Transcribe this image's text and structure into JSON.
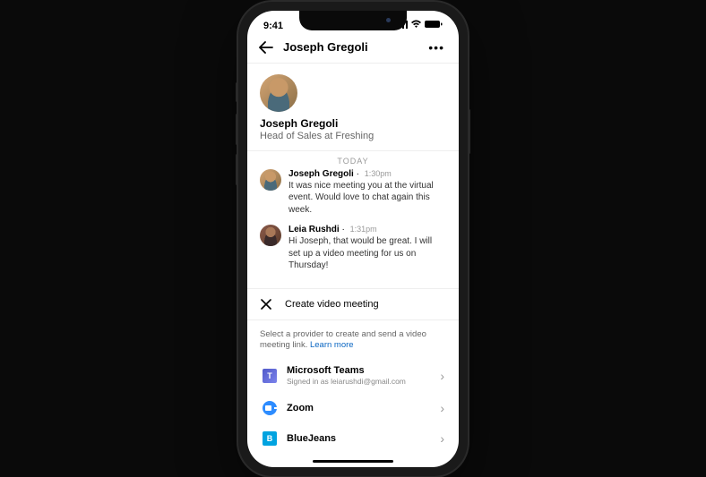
{
  "status": {
    "time": "9:41"
  },
  "header": {
    "title": "Joseph Gregoli"
  },
  "profile": {
    "name": "Joseph Gregoli",
    "subtitle": "Head of Sales at Freshing"
  },
  "date_label": "TODAY",
  "messages": [
    {
      "name": "Joseph Gregoli",
      "time": "1:30pm",
      "text": "It was nice meeting you at the virtual event. Would love to chat again this week.",
      "avatar": "joseph"
    },
    {
      "name": "Leia Rushdi",
      "time": "1:31pm",
      "text": "Hi Joseph, that would be great. I will set up a video meeting for us on Thursday!",
      "avatar": "leia"
    }
  ],
  "sheet": {
    "title": "Create video meeting",
    "desc_text": "Select a provider to create and send a video meeting link. ",
    "learn_more": "Learn more"
  },
  "providers": [
    {
      "name": "Microsoft Teams",
      "sub": "Signed in as leiarushdi@gmail.com",
      "icon": "teams"
    },
    {
      "name": "Zoom",
      "sub": "",
      "icon": "zoom"
    },
    {
      "name": "BlueJeans",
      "sub": "",
      "icon": "bluejeans"
    }
  ]
}
